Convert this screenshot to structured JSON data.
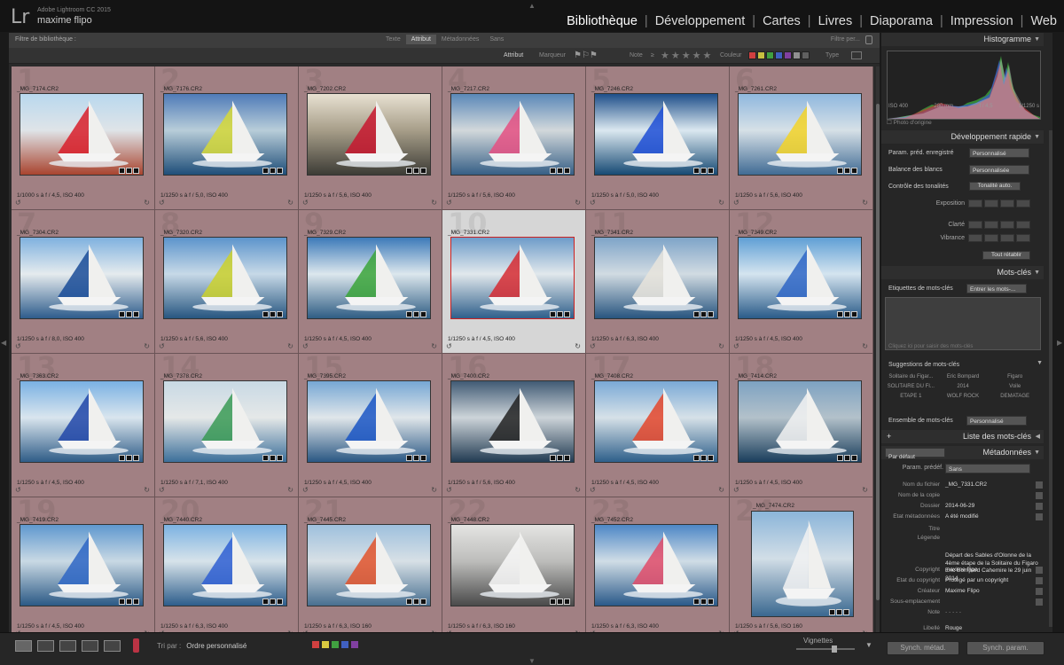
{
  "app": {
    "name": "Adobe Lightroom CC 2015",
    "user": "maxime flipo",
    "logo": "Lr"
  },
  "modules": [
    "Bibliothèque",
    "Développement",
    "Cartes",
    "Livres",
    "Diaporama",
    "Impression",
    "Web"
  ],
  "active_module": "Bibliothèque",
  "filter": {
    "title": "Filtre de bibliothèque :",
    "tabs": [
      "Texte",
      "Attribut",
      "Métadonnées",
      "Sans"
    ],
    "active_tab": "Attribut",
    "preset": "Filtre per...",
    "attr_label": "Attribut",
    "marker_label": "Marqueur",
    "note_label": "Note",
    "note_op": "≥",
    "stars": "★★★★★",
    "color_label": "Couleur",
    "type_label": "Type",
    "colors": [
      "#d04040",
      "#c8c040",
      "#40a040",
      "#4060c0",
      "#8040a0",
      "#909090",
      "#606060"
    ]
  },
  "thumbnails": [
    {
      "file": "_MG_7174.CR2",
      "num": "1",
      "meta": "1/1000 s à f / 4,5, ISO 400",
      "orientation": "landscape",
      "bg": [
        "#b9d8ee",
        "#dfe4e8",
        "#a9442f"
      ],
      "accent": "#d81f2a"
    },
    {
      "file": "_MG_7176.CR2",
      "num": "2",
      "meta": "1/1250 s à f / 5,0, ISO 400",
      "orientation": "landscape",
      "bg": [
        "#4f7bb8",
        "#b8cdd9",
        "#1f4e79"
      ],
      "accent": "#d5d838"
    },
    {
      "file": "_MG_7202.CR2",
      "num": "3",
      "meta": "1/1250 s à f / 5,6, ISO 400",
      "orientation": "landscape",
      "bg": [
        "#e8e1d2",
        "#a79e89",
        "#3d3c36"
      ],
      "accent": "#c8182f"
    },
    {
      "file": "_MG_7217.CR2",
      "num": "4",
      "meta": "1/1250 s à f / 5,6, ISO 400",
      "orientation": "landscape",
      "bg": [
        "#5a88b8",
        "#d2d8db",
        "#365f86"
      ],
      "accent": "#e55082"
    },
    {
      "file": "_MG_7246.CR2",
      "num": "5",
      "meta": "1/1250 s à f / 5,0, ISO 400",
      "orientation": "landscape",
      "bg": [
        "#1e4f8a",
        "#dbe8f0",
        "#174a74"
      ],
      "accent": "#1f4fd6"
    },
    {
      "file": "_MG_7261.CR2",
      "num": "6",
      "meta": "1/1250 s à f / 5,6, ISO 400",
      "orientation": "landscape",
      "bg": [
        "#8fb8de",
        "#d6e0e7",
        "#406b94"
      ],
      "accent": "#f3d328"
    },
    {
      "file": "_MG_7304.CR2",
      "num": "7",
      "meta": "1/1250 s à f / 8,0, ISO 400",
      "orientation": "landscape",
      "bg": [
        "#7fb1df",
        "#e5ebee",
        "#2e5c8c"
      ],
      "accent": "#1a4c98"
    },
    {
      "file": "_MG_7320.CR2",
      "num": "8",
      "meta": "1/1250 s à f / 5,6, ISO 400",
      "orientation": "landscape",
      "bg": [
        "#5c94cc",
        "#c7d9e7",
        "#275680"
      ],
      "accent": "#cbd12d"
    },
    {
      "file": "_MG_7329.CR2",
      "num": "9",
      "meta": "1/1250 s à f / 4,5, ISO 400",
      "orientation": "landscape",
      "bg": [
        "#3c7ab9",
        "#dce7ed",
        "#2f5d84"
      ],
      "accent": "#3ba43a"
    },
    {
      "file": "_MG_7331.CR2",
      "num": "10",
      "meta": "1/1250 s à f / 4,5, ISO 400",
      "orientation": "landscape",
      "bg": [
        "#6e9cc9",
        "#e1e8ec",
        "#2f5f8b"
      ],
      "accent": "#d62c33",
      "selected": true
    },
    {
      "file": "_MG_7341.CR2",
      "num": "11",
      "meta": "1/1250 s à f / 6,3, ISO 400",
      "orientation": "landscape",
      "bg": [
        "#7ea4c8",
        "#d1dbe2",
        "#28557f"
      ],
      "accent": "#e8e4dc"
    },
    {
      "file": "_MG_7349.CR2",
      "num": "12",
      "meta": "1/1250 s à f / 4,5, ISO 400",
      "orientation": "landscape",
      "bg": [
        "#5f9fd5",
        "#d4e4ef",
        "#2a5b89"
      ],
      "accent": "#2f66c6"
    },
    {
      "file": "_MG_7363.CR2",
      "num": "13",
      "meta": "1/1250 s à f / 4,5, ISO 400",
      "orientation": "landscape",
      "bg": [
        "#7ab1e3",
        "#d9e5ee",
        "#2f5c87"
      ],
      "accent": "#2147a8"
    },
    {
      "file": "_MG_7378.CR2",
      "num": "14",
      "meta": "1/1250 s à f / 7,1, ISO 400",
      "orientation": "landscape",
      "bg": [
        "#c8d9e4",
        "#e5e8e8",
        "#3c6f9a"
      ],
      "accent": "#3a9a55"
    },
    {
      "file": "_MG_7395.CR2",
      "num": "15",
      "meta": "1/1250 s à f / 4,5, ISO 400",
      "orientation": "landscape",
      "bg": [
        "#76a7d4",
        "#e0e6ea",
        "#2a5783"
      ],
      "accent": "#1b56c4"
    },
    {
      "file": "_MG_7400.CR2",
      "num": "16",
      "meta": "1/1250 s à f / 5,6, ISO 400",
      "orientation": "landscape",
      "bg": [
        "#415b75",
        "#cdd4d9",
        "#223b52"
      ],
      "accent": "#232323"
    },
    {
      "file": "_MG_7408.CR2",
      "num": "17",
      "meta": "1/1250 s à f / 4,5, ISO 400",
      "orientation": "landscape",
      "bg": [
        "#7aa9d6",
        "#d6e1e8",
        "#2e5f8a"
      ],
      "accent": "#e4472c"
    },
    {
      "file": "_MG_7414.CR2",
      "num": "18",
      "meta": "1/1250 s à f / 4,5, ISO 400",
      "orientation": "landscape",
      "bg": [
        "#7da2c2",
        "#b3c1ca",
        "#1a3e5c"
      ],
      "accent": "#f2f2f2"
    },
    {
      "file": "_MG_7419.CR2",
      "num": "19",
      "meta": "1/1250 s à f / 4,5, ISO 400",
      "orientation": "landscape",
      "bg": [
        "#5f98cf",
        "#c9d9e4",
        "#2b5985"
      ],
      "accent": "#2e66c4"
    },
    {
      "file": "_MG_7440.CR2",
      "num": "20",
      "meta": "1/1250 s à f / 6,3, ISO 400",
      "orientation": "landscape",
      "bg": [
        "#7cb2e2",
        "#d7e3ea",
        "#2d5d8b"
      ],
      "accent": "#2f5fd2"
    },
    {
      "file": "_MG_7445.CR2",
      "num": "21",
      "meta": "1/1250 s à f / 6,3, ISO 160",
      "orientation": "landscape",
      "bg": [
        "#9ec0dd",
        "#d7e0e6",
        "#486f90"
      ],
      "accent": "#e2542c"
    },
    {
      "file": "_MG_7448.CR2",
      "num": "22",
      "meta": "1/1250 s à f / 6,3, ISO 160",
      "orientation": "landscape",
      "bg": [
        "#e4e4e2",
        "#bdbdbb",
        "#4a4a4a"
      ],
      "accent": "#f8f8f8"
    },
    {
      "file": "_MG_7452.CR2",
      "num": "23",
      "meta": "1/1250 s à f / 6,3, ISO 400",
      "orientation": "landscape",
      "bg": [
        "#4d87c6",
        "#d0dde6",
        "#2a5989"
      ],
      "accent": "#e24c6a"
    },
    {
      "file": "_MG_7474.CR2",
      "num": "24",
      "meta": "1/1250 s à f / 5,6, ISO 160",
      "orientation": "portrait",
      "bg": [
        "#8bb5d9",
        "#d2dee7",
        "#3a6890"
      ],
      "accent": "#f2f2f2"
    }
  ],
  "histogram": {
    "title": "Histogramme",
    "iso": "ISO 400",
    "focal": "280 mm",
    "aperture": "f / 4,5",
    "shutter": "1/1250 s",
    "photo_origine": "Photo d'origine"
  },
  "quick_develop": {
    "title": "Développement rapide",
    "preset_label": "Param. préd. enregistré",
    "preset_value": "Personnalisé",
    "wb_label": "Balance des blancs",
    "wb_value": "Personnalisée",
    "tone_label": "Contrôle des tonalités",
    "tone_auto": "Tonalité auto.",
    "exposure": "Exposition",
    "clarity": "Clarté",
    "vibrance": "Vibrance",
    "reset": "Tout rétablir"
  },
  "keywords": {
    "title": "Mots-clés",
    "tags_label": "Etiquettes de mots-clés",
    "tags_value": "Entrer les mots-...",
    "placeholder": "Cliquez ici pour saisir des mots-clés",
    "suggestions_label": "Suggestions de mots-clés",
    "suggestions": [
      "Solitaire du Figar...",
      "Eric Bompard",
      "Figaro",
      "SOLITAIRE DU FI...",
      "2014",
      "Voile",
      "ETAPE 1",
      "WOLF ROCK",
      "DEMATAGE"
    ],
    "set_label": "Ensemble de mots-clés",
    "set_value": "Personnalisé",
    "list_title": "Liste des mots-clés"
  },
  "metadata": {
    "title": "Métadonnées",
    "preset_dd": "Par défaut",
    "preset_label": "Param. prédéf.",
    "preset_value": "Sans",
    "rows": [
      {
        "label": "Nom du fichier",
        "value": "_MG_7331.CR2"
      },
      {
        "label": "Nom de la copie",
        "value": ""
      },
      {
        "label": "Dossier",
        "value": "2014-06-29"
      },
      {
        "label": "Etat métadonnées",
        "value": "A été modifié"
      }
    ],
    "title_label": "Titre",
    "legend_label": "Légende",
    "legend_value": "Départ des Sables d'Olonne de la 4ème étape de la Solitaire du Figaro Eric Bompard Cahemire le 29 juin 2014",
    "rows2": [
      {
        "label": "Copyright",
        "value": "maxime flipo"
      },
      {
        "label": "Etat du copyright",
        "value": "Protégé par un copyright"
      },
      {
        "label": "Créateur",
        "value": "Maxime Flipo"
      },
      {
        "label": "Sous-emplacement",
        "value": ""
      }
    ],
    "note_label": "Note",
    "note_value": "· · · · ·",
    "libelle_label": "Libellé",
    "libelle_value": "Rouge"
  },
  "bottom": {
    "sort_label": "Tri par :",
    "sort_value": "Ordre personnalisé",
    "vignettes": "Vignettes",
    "sync_meta": "Synch. métad.",
    "sync_param": "Synch. param.",
    "colors": [
      "#d04040",
      "#d8c840",
      "#40a040",
      "#4060c0",
      "#8040a0"
    ]
  }
}
